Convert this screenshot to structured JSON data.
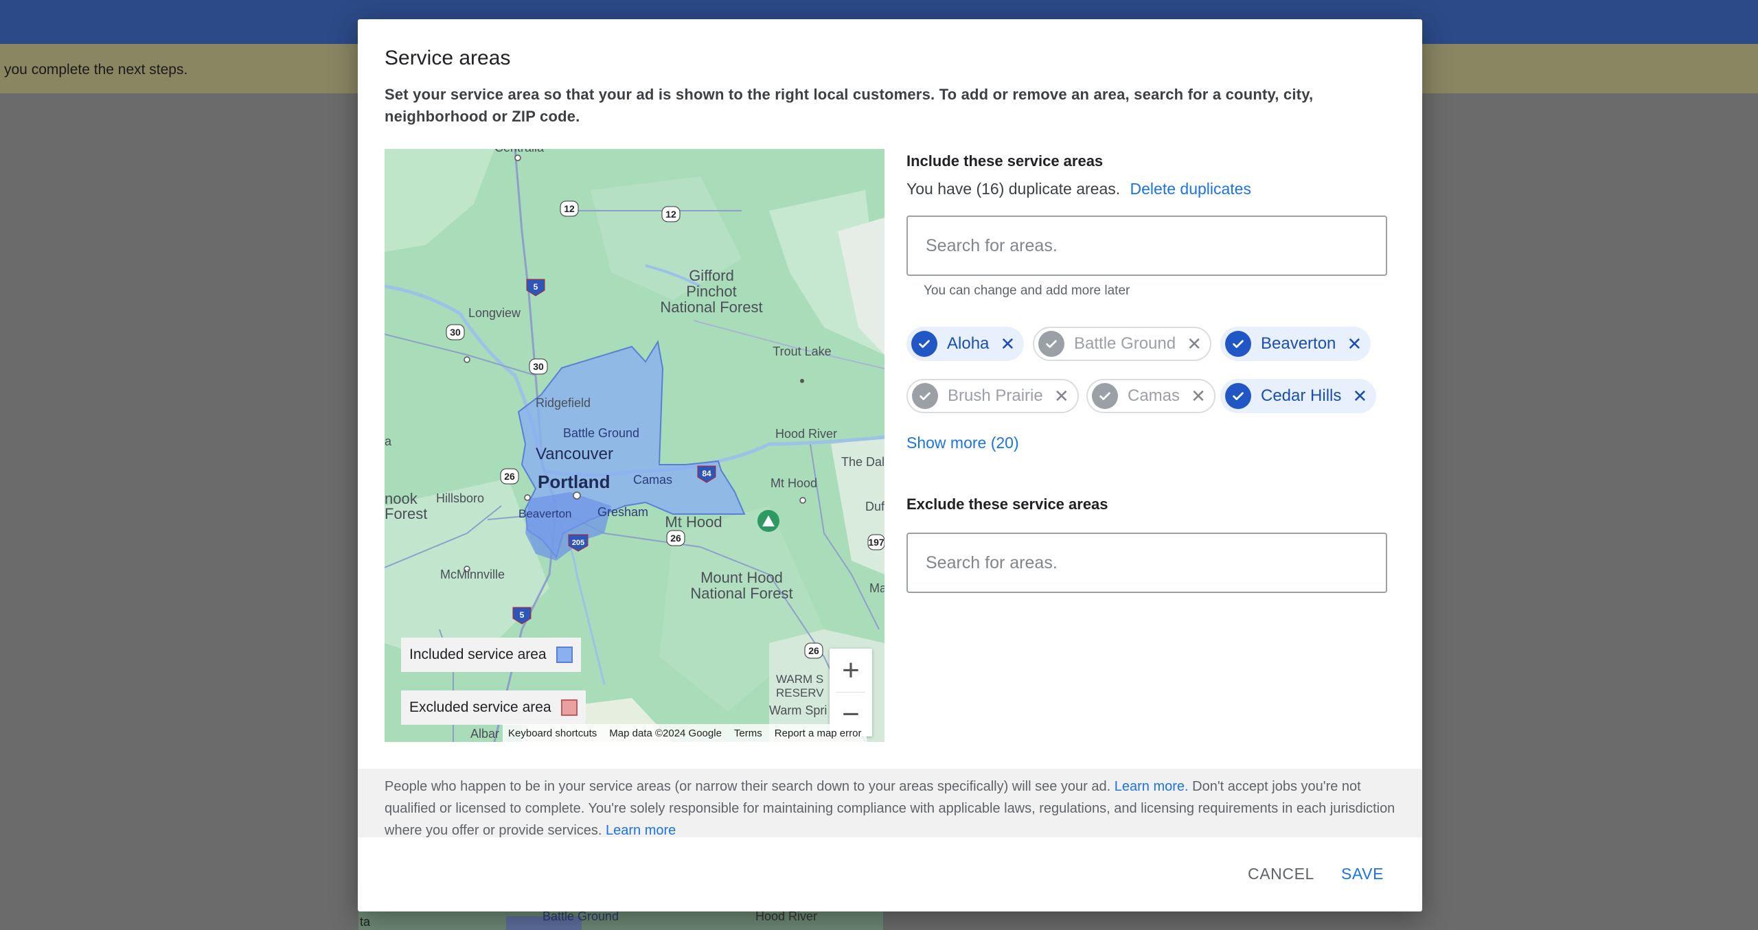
{
  "background": {
    "notice_text": "you complete the next steps.",
    "map_label_1": "Battle Ground",
    "map_label_2": "Hood River",
    "map_label_3": "ta"
  },
  "dialog": {
    "title": "Service areas",
    "description": "Set your service area so that your ad is shown to the right local customers. To add or remove an area, search for a county, city, neighborhood or ZIP code."
  },
  "map": {
    "labels": {
      "centralia": "Centralia",
      "gifford1": "Gifford",
      "gifford2": "Pinchot",
      "gifford3": "National Forest",
      "longview": "Longview",
      "trout_lake": "Trout Lake",
      "ridgefield": "Ridgefield",
      "battle_ground": "Battle Ground",
      "hood_river": "Hood River",
      "vancouver": "Vancouver",
      "the_dalles": "The Dal",
      "portland": "Portland",
      "camas": "Camas",
      "mt_hood": "Mt Hood",
      "mt_hood2": "Mt Hood",
      "hillsboro": "Hillsboro",
      "beaverton": "Beaverton",
      "gresham": "Gresham",
      "nook": "nook",
      "forest": "Forest",
      "a": "a",
      "duf": "Duf",
      "ma": "Ma",
      "mcminnville": "McMinnville",
      "mount_hood1": "Mount Hood",
      "mount_hood2": "National Forest",
      "warm1": "WARM S",
      "warm2": "RESERV",
      "warm3": "Warm Spri",
      "albany": "Albar"
    },
    "shields": [
      "12",
      "12",
      "5",
      "30",
      "30",
      "26",
      "84",
      "26",
      "205",
      "26",
      "5",
      "26",
      "197"
    ],
    "legend_included": "Included service area",
    "legend_excluded": "Excluded service area",
    "included_color": "#8ab0f0",
    "excluded_color": "#e8a0a0",
    "zoom_in": "+",
    "zoom_out": "−",
    "attribution": {
      "shortcuts": "Keyboard shortcuts",
      "data": "Map data ©2024 Google",
      "terms": "Terms",
      "report": "Report a map error"
    }
  },
  "include": {
    "heading": "Include these service areas",
    "duplicate_text": "You have (16) duplicate areas.",
    "delete_duplicates": "Delete duplicates",
    "search_placeholder": "Search for areas.",
    "hint": "You can change and add more later",
    "chips": [
      {
        "label": "Aloha",
        "selected": true
      },
      {
        "label": "Battle Ground",
        "selected": false
      },
      {
        "label": "Beaverton",
        "selected": true
      },
      {
        "label": "Brush Prairie",
        "selected": false
      },
      {
        "label": "Camas",
        "selected": false
      },
      {
        "label": "Cedar Hills",
        "selected": true
      }
    ],
    "show_more": "Show more (20)"
  },
  "exclude": {
    "heading": "Exclude these service areas",
    "search_placeholder": "Search for areas."
  },
  "footer": {
    "note_part1": "People who happen to be in your service areas (or narrow their search down to your areas specifically) will see your ad.",
    "learn_more_1": "Learn more.",
    "note_part2": "Don't accept jobs you're not qualified or licensed to complete. You're solely responsible for maintaining compliance with applicable laws, regulations, and licensing requirements in each jurisdiction where you offer or provide services.",
    "learn_more_2": "Learn more",
    "cancel": "CANCEL",
    "save": "SAVE"
  },
  "colors": {
    "accent": "#1a73e8",
    "chip_selected_bg": "#e8f0fe",
    "check_selected": "#2157c4"
  }
}
